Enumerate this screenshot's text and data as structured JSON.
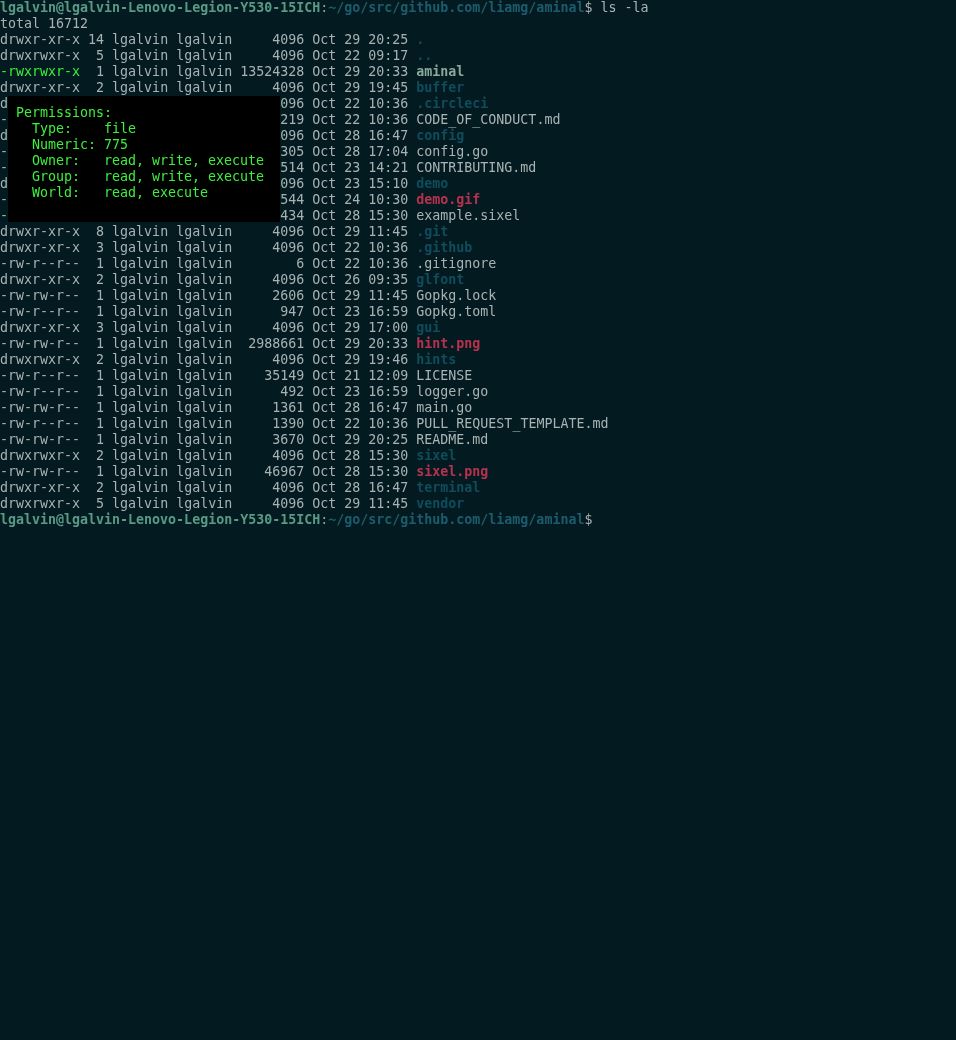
{
  "prompt_top": {
    "user": "lgalvin@lgalvin-Lenovo-Legion-Y530-15ICH",
    "separator": ":",
    "path": "~/go/src/github.com/liamg/aminal",
    "symbol": "$",
    "command": "ls -la"
  },
  "total": "total 16712",
  "rows": [
    {
      "kind": "entry",
      "perms": "drwxr-xr-x",
      "links": "14",
      "owner": "lgalvin",
      "group": "lgalvin",
      "size": "4096",
      "date": "Oct 29 20:25",
      "name": ".",
      "color": "#0f4c5c",
      "bold": true,
      "highlighted": false
    },
    {
      "kind": "entry",
      "perms": "drwxrwxr-x",
      "links": "5",
      "owner": "lgalvin",
      "group": "lgalvin",
      "size": "4096",
      "date": "Oct 22 09:17",
      "name": "..",
      "color": "#0f4c5c",
      "bold": true,
      "highlighted": false
    },
    {
      "kind": "entry",
      "perms": "-rwxrwxr-x",
      "links": "1",
      "owner": "lgalvin",
      "group": "lgalvin",
      "size": "13524328",
      "date": "Oct 29 20:33",
      "name": "aminal",
      "color": "#8aa99b",
      "bold": true,
      "highlighted": true
    },
    {
      "kind": "entry",
      "perms": "drwxr-xr-x",
      "links": "2",
      "owner": "lgalvin",
      "group": "lgalvin",
      "size": "4096",
      "date": "Oct 29 19:45",
      "name": "buffer",
      "color": "#0f4c5c",
      "bold": true,
      "highlighted": false
    },
    {
      "kind": "covered",
      "lead": "d",
      "tail": "096 Oct 22 10:36",
      "name": ".circleci",
      "color": "#0f4c5c",
      "bold": true
    },
    {
      "kind": "covered",
      "lead": "-",
      "tail": "219 Oct 22 10:36",
      "name": "CODE_OF_CONDUCT.md",
      "color": "#aab3b3",
      "bold": false
    },
    {
      "kind": "covered",
      "lead": "d",
      "tail": "096 Oct 28 16:47",
      "name": "config",
      "color": "#0f4c5c",
      "bold": true
    },
    {
      "kind": "covered",
      "lead": "-",
      "tail": "305 Oct 28 17:04",
      "name": "config.go",
      "color": "#aab3b3",
      "bold": false
    },
    {
      "kind": "covered",
      "lead": "-",
      "tail": "514 Oct 23 14:21",
      "name": "CONTRIBUTING.md",
      "color": "#aab3b3",
      "bold": false
    },
    {
      "kind": "covered",
      "lead": "d",
      "tail": "096 Oct 23 15:10",
      "name": "demo",
      "color": "#0f4c5c",
      "bold": true
    },
    {
      "kind": "covered",
      "lead": "-",
      "tail": "544 Oct 24 10:30",
      "name": "demo.gif",
      "color": "#b8324f",
      "bold": true
    },
    {
      "kind": "covered",
      "lead": "-",
      "tail": "434 Oct 28 15:30",
      "name": "example.sixel",
      "color": "#aab3b3",
      "bold": false
    },
    {
      "kind": "entry",
      "perms": "drwxr-xr-x",
      "links": "8",
      "owner": "lgalvin",
      "group": "lgalvin",
      "size": "4096",
      "date": "Oct 29 11:45",
      "name": ".git",
      "color": "#0f4c5c",
      "bold": true,
      "highlighted": false
    },
    {
      "kind": "entry",
      "perms": "drwxr-xr-x",
      "links": "3",
      "owner": "lgalvin",
      "group": "lgalvin",
      "size": "4096",
      "date": "Oct 22 10:36",
      "name": ".github",
      "color": "#0f4c5c",
      "bold": true,
      "highlighted": false
    },
    {
      "kind": "entry",
      "perms": "-rw-r--r--",
      "links": "1",
      "owner": "lgalvin",
      "group": "lgalvin",
      "size": "6",
      "date": "Oct 22 10:36",
      "name": ".gitignore",
      "color": "#aab3b3",
      "bold": false,
      "highlighted": false
    },
    {
      "kind": "entry",
      "perms": "drwxr-xr-x",
      "links": "2",
      "owner": "lgalvin",
      "group": "lgalvin",
      "size": "4096",
      "date": "Oct 26 09:35",
      "name": "glfont",
      "color": "#0f4c5c",
      "bold": true,
      "highlighted": false
    },
    {
      "kind": "entry",
      "perms": "-rw-rw-r--",
      "links": "1",
      "owner": "lgalvin",
      "group": "lgalvin",
      "size": "2606",
      "date": "Oct 29 11:45",
      "name": "Gopkg.lock",
      "color": "#aab3b3",
      "bold": false,
      "highlighted": false
    },
    {
      "kind": "entry",
      "perms": "-rw-r--r--",
      "links": "1",
      "owner": "lgalvin",
      "group": "lgalvin",
      "size": "947",
      "date": "Oct 23 16:59",
      "name": "Gopkg.toml",
      "color": "#aab3b3",
      "bold": false,
      "highlighted": false
    },
    {
      "kind": "entry",
      "perms": "drwxr-xr-x",
      "links": "3",
      "owner": "lgalvin",
      "group": "lgalvin",
      "size": "4096",
      "date": "Oct 29 17:00",
      "name": "gui",
      "color": "#0f4c5c",
      "bold": true,
      "highlighted": false
    },
    {
      "kind": "entry",
      "perms": "-rw-rw-r--",
      "links": "1",
      "owner": "lgalvin",
      "group": "lgalvin",
      "size": "2988661",
      "date": "Oct 29 20:33",
      "name": "hint.png",
      "color": "#b8324f",
      "bold": true,
      "highlighted": false
    },
    {
      "kind": "entry",
      "perms": "drwxrwxr-x",
      "links": "2",
      "owner": "lgalvin",
      "group": "lgalvin",
      "size": "4096",
      "date": "Oct 29 19:46",
      "name": "hints",
      "color": "#0f4c5c",
      "bold": true,
      "highlighted": false
    },
    {
      "kind": "entry",
      "perms": "-rw-r--r--",
      "links": "1",
      "owner": "lgalvin",
      "group": "lgalvin",
      "size": "35149",
      "date": "Oct 21 12:09",
      "name": "LICENSE",
      "color": "#aab3b3",
      "bold": false,
      "highlighted": false
    },
    {
      "kind": "entry",
      "perms": "-rw-r--r--",
      "links": "1",
      "owner": "lgalvin",
      "group": "lgalvin",
      "size": "492",
      "date": "Oct 23 16:59",
      "name": "logger.go",
      "color": "#aab3b3",
      "bold": false,
      "highlighted": false
    },
    {
      "kind": "entry",
      "perms": "-rw-rw-r--",
      "links": "1",
      "owner": "lgalvin",
      "group": "lgalvin",
      "size": "1361",
      "date": "Oct 28 16:47",
      "name": "main.go",
      "color": "#aab3b3",
      "bold": false,
      "highlighted": false
    },
    {
      "kind": "entry",
      "perms": "-rw-r--r--",
      "links": "1",
      "owner": "lgalvin",
      "group": "lgalvin",
      "size": "1390",
      "date": "Oct 22 10:36",
      "name": "PULL_REQUEST_TEMPLATE.md",
      "color": "#aab3b3",
      "bold": false,
      "highlighted": false
    },
    {
      "kind": "entry",
      "perms": "-rw-rw-r--",
      "links": "1",
      "owner": "lgalvin",
      "group": "lgalvin",
      "size": "3670",
      "date": "Oct 29 20:25",
      "name": "README.md",
      "color": "#aab3b3",
      "bold": false,
      "highlighted": false
    },
    {
      "kind": "entry",
      "perms": "drwxrwxr-x",
      "links": "2",
      "owner": "lgalvin",
      "group": "lgalvin",
      "size": "4096",
      "date": "Oct 28 15:30",
      "name": "sixel",
      "color": "#0f4c5c",
      "bold": true,
      "highlighted": false
    },
    {
      "kind": "entry",
      "perms": "-rw-rw-r--",
      "links": "1",
      "owner": "lgalvin",
      "group": "lgalvin",
      "size": "46967",
      "date": "Oct 28 15:30",
      "name": "sixel.png",
      "color": "#b8324f",
      "bold": true,
      "highlighted": false
    },
    {
      "kind": "entry",
      "perms": "drwxr-xr-x",
      "links": "2",
      "owner": "lgalvin",
      "group": "lgalvin",
      "size": "4096",
      "date": "Oct 28 16:47",
      "name": "terminal",
      "color": "#0f4c5c",
      "bold": true,
      "highlighted": false
    },
    {
      "kind": "entry",
      "perms": "drwxrwxr-x",
      "links": "5",
      "owner": "lgalvin",
      "group": "lgalvin",
      "size": "4096",
      "date": "Oct 29 11:45",
      "name": "vendor",
      "color": "#0f4c5c",
      "bold": true,
      "highlighted": false
    }
  ],
  "prompt_bottom": {
    "user": "lgalvin@lgalvin-Lenovo-Legion-Y530-15ICH",
    "separator": ":",
    "path": "~/go/src/github.com/liamg/aminal",
    "symbol": "$"
  },
  "tooltip": {
    "title": "Permissions:",
    "fields": [
      {
        "label": "Type:",
        "value": "file"
      },
      {
        "label": "Numeric:",
        "value": "775"
      },
      {
        "label": "Owner:",
        "value": "read, write, execute"
      },
      {
        "label": "Group:",
        "value": "read, write, execute"
      },
      {
        "label": "World:",
        "value": "read, execute"
      }
    ]
  }
}
